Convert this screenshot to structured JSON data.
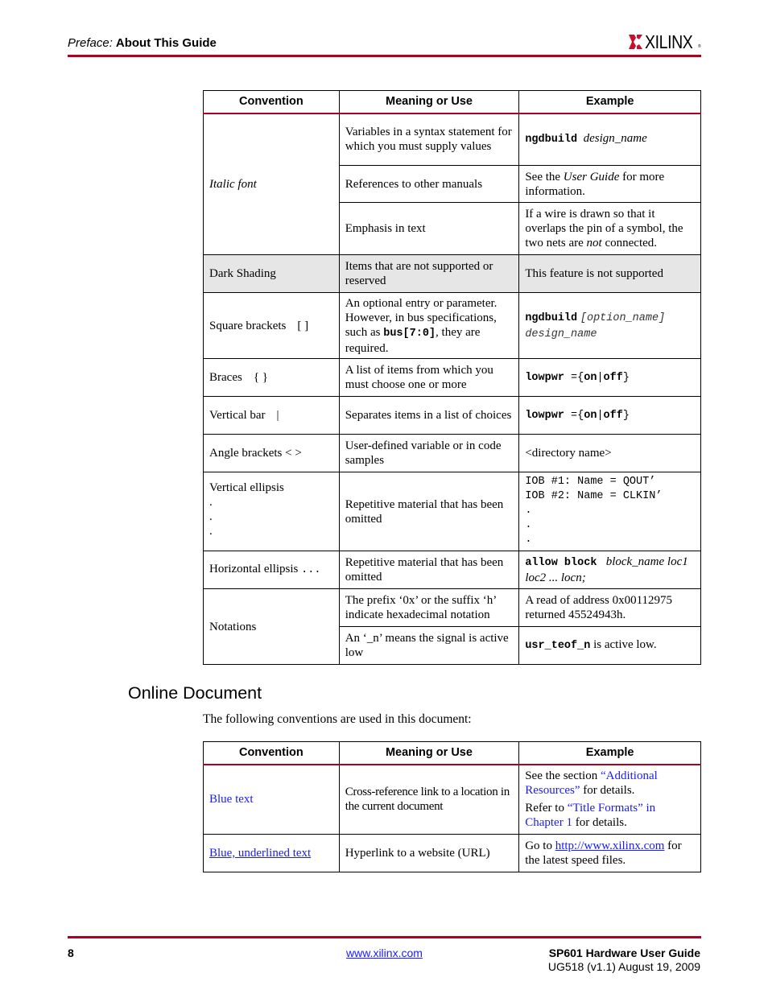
{
  "header": {
    "prefix": "Preface:",
    "title": "About This Guide",
    "logo_text": "XILINX",
    "logo_reg": "®",
    "accent_color": "#b00020"
  },
  "table1": {
    "columns": [
      "Convention",
      "Meaning or Use",
      "Example"
    ],
    "italic_font": {
      "convention": "Italic font",
      "rows": [
        {
          "meaning": "Variables in a syntax statement for which you must supply values",
          "ex_code": "ngdbuild",
          "ex_italic": "design_name"
        },
        {
          "meaning": "References to other manuals",
          "ex_pre": "See the ",
          "ex_italic": "User Guide",
          "ex_post": " for more information."
        },
        {
          "meaning": "Emphasis in text",
          "ex_pre": "If a wire is drawn so that it overlaps the pin of a symbol, the two nets are ",
          "ex_italic": "not",
          "ex_post": " connected."
        }
      ]
    },
    "dark_shading": {
      "convention": "Dark Shading",
      "meaning": "Items that are not supported or reserved",
      "example": "This feature is not supported"
    },
    "square_brackets": {
      "convention": "Square brackets",
      "symbol": "[ ]",
      "meaning_pre": "An optional entry or parameter. However, in bus specifications, such as ",
      "meaning_code": "bus[7:0]",
      "meaning_post": ", they are required.",
      "ex_code": "ngdbuild",
      "ex_opt": "[option_name]",
      "ex_design": "design_name"
    },
    "braces": {
      "convention": "Braces",
      "symbol": "{ }",
      "meaning": "A list of items from which you must choose one or more",
      "ex_code": "lowpwr",
      "ex_eq": " ={",
      "ex_on": "on",
      "ex_bar": "|",
      "ex_off": "off",
      "ex_close": "}"
    },
    "vertical_bar": {
      "convention": "Vertical bar",
      "symbol": "|",
      "meaning": "Separates items in a list of choices",
      "ex_code": "lowpwr",
      "ex_eq": " ={",
      "ex_on": "on",
      "ex_bar": "|",
      "ex_off": "off",
      "ex_close": "}"
    },
    "angle_brackets": {
      "convention": "Angle brackets < >",
      "meaning": "User-defined variable or in code samples",
      "example": "<directory name>"
    },
    "vertical_ellipsis": {
      "convention": "Vertical ellipsis",
      "meaning": "Repetitive material that has been omitted",
      "ex_line1": "IOB #1: Name = QOUT’",
      "ex_line2": "IOB #2: Name = CLKIN’",
      "dot": "."
    },
    "horizontal_ellipsis": {
      "convention": "Horizontal ellipsis",
      "symbol": "...",
      "meaning": "Repetitive material that has been omitted",
      "ex_code": "allow block",
      "ex_italic": "block_name loc1 loc2 ... locn;"
    },
    "notations": {
      "convention": "Notations",
      "rows": [
        {
          "meaning": "The prefix ‘0x’ or the suffix ‘h’ indicate hexadecimal notation",
          "example": "A read of address 0x00112975 returned 45524943h."
        },
        {
          "meaning": "An ‘_n’ means the signal is active low",
          "ex_code": "usr_teof_n",
          "ex_post": " is active low."
        }
      ]
    }
  },
  "online": {
    "title": "Online Document",
    "intro": "The following conventions are used in this document:",
    "columns": [
      "Convention",
      "Meaning or Use",
      "Example"
    ],
    "blue_text": {
      "convention": "Blue text",
      "meaning": "Cross-reference link to a location in the current document",
      "ex1_pre": "See the section ",
      "ex1_link": "“Additional Resources”",
      "ex1_post": " for details.",
      "ex2_pre": "Refer to ",
      "ex2_link": "“Title Formats” in Chapter 1",
      "ex2_post": " for details."
    },
    "underlined": {
      "convention": "Blue, underlined text",
      "meaning": "Hyperlink to a website (URL)",
      "ex_pre": "Go to ",
      "ex_link": "http://www.xilinx.com",
      "ex_post": " for the latest speed files."
    },
    "link_color": "#1a1aff"
  },
  "footer": {
    "page_number": "8",
    "website": "www.xilinx.com",
    "guide_title": "SP601 Hardware User Guide",
    "revision": "UG518 (v1.1) August 19, 2009"
  }
}
